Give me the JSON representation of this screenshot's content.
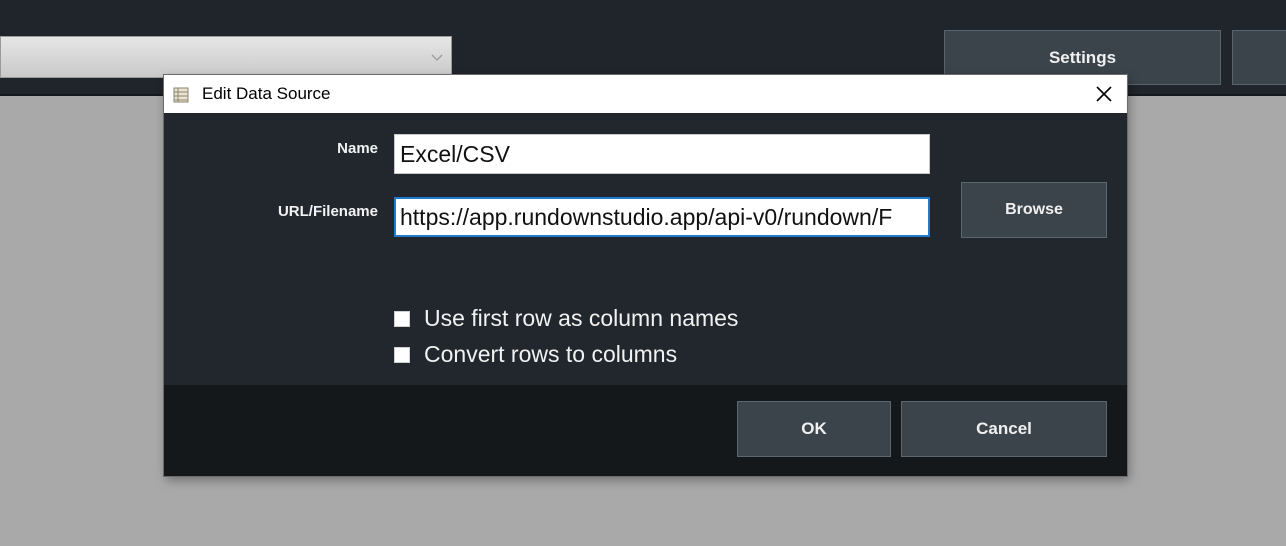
{
  "background": {
    "settings_label": "Settings"
  },
  "dialog": {
    "title": "Edit Data Source",
    "title_icon": "data-source-icon",
    "close_icon": "close-icon",
    "name_label": "Name",
    "name_value": "Excel/CSV",
    "url_label": "URL/Filename",
    "url_value": "https://app.rundownstudio.app/api-v0/rundown/F",
    "browse_label": "Browse",
    "checkboxes": [
      {
        "label": "Use first row as column names",
        "checked": false
      },
      {
        "label": "Convert rows to columns",
        "checked": false
      }
    ],
    "ok_label": "OK",
    "cancel_label": "Cancel"
  },
  "colors": {
    "dialog_bg": "#22272d",
    "footer_bg": "#14181b",
    "button_bg": "#3b434b",
    "focus_border": "#1f7ad0",
    "workspace_bg": "#a9a9a9"
  }
}
